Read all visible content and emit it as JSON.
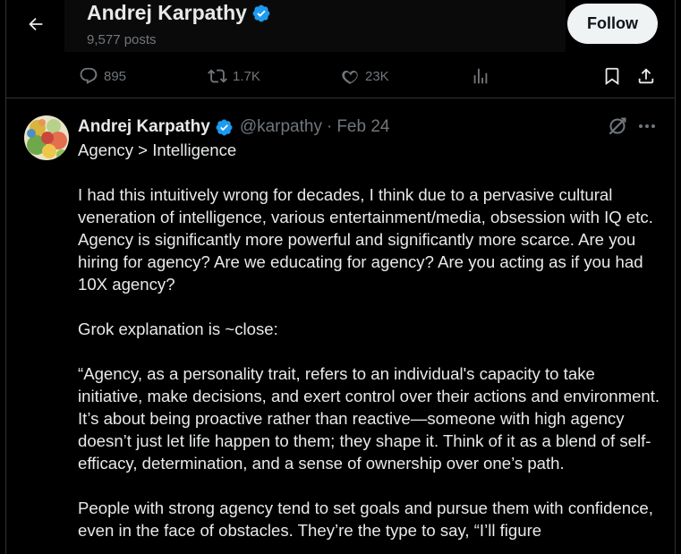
{
  "header": {
    "title": "Andrej Karpathy",
    "posts": "9,577 posts",
    "follow_label": "Follow"
  },
  "actions": {
    "replies": "895",
    "reposts": "1.7K",
    "likes": "23K"
  },
  "tweet": {
    "name": "Andrej Karpathy",
    "handle": "@karpathy",
    "separator": "·",
    "date": "Feb 24",
    "paragraphs": [
      "Agency > Intelligence",
      "I had this intuitively wrong for decades, I think due to a pervasive cultural veneration of intelligence, various entertainment/media, obsession with IQ etc. Agency is significantly more powerful and significantly more scarce. Are you hiring for agency? Are we educating for agency? Are you acting as if you had 10X agency?",
      "Grok explanation is ~close:",
      "“Agency, as a personality trait, refers to an individual's capacity to take initiative, make decisions, and exert control over their actions and environment. It’s about being proactive rather than reactive—someone with high agency doesn’t just let life happen to them; they shape it. Think of it as a blend of self-efficacy, determination, and a sense of ownership over one’s path.",
      "People with strong agency tend to set goals and pursue them with confidence, even in the face of obstacles. They’re the type to say, “I’ll figure"
    ]
  },
  "colors": {
    "background": "#000000",
    "text": "#e7e9ea",
    "muted": "#71767b",
    "verified": "#1d9bf0",
    "follow_bg": "#eff3f4",
    "border": "#2f3336"
  },
  "icons": {
    "back": "arrow-left-icon",
    "verified": "verified-badge-icon",
    "reply": "reply-icon",
    "repost": "repost-icon",
    "like": "heart-icon",
    "views": "views-icon",
    "bookmark": "bookmark-icon",
    "share": "share-icon",
    "grok": "grok-icon",
    "more": "more-icon"
  }
}
